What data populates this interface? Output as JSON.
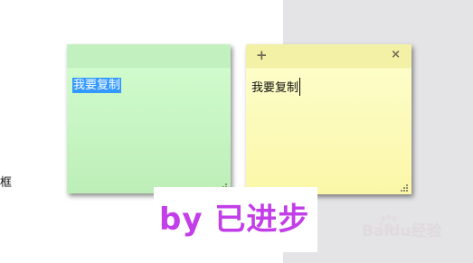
{
  "left_edge_text": "框",
  "notes": [
    {
      "color": "green",
      "header_bg": "#c2f0be",
      "body_text": "我要复制",
      "text_selected": true
    },
    {
      "color": "yellow",
      "header_bg": "#f3f1a5",
      "add_glyph": "+",
      "close_glyph": "×",
      "body_text": "我要复制",
      "has_caret": true
    }
  ],
  "watermark": {
    "text": "by 已进步",
    "color": "#c23ee8"
  },
  "baidu_logo": {
    "text": "Baidu经验",
    "color": "#e0dadd"
  },
  "colors": {
    "selection": "#3399ff",
    "right_panel": "#e4e4e6"
  }
}
